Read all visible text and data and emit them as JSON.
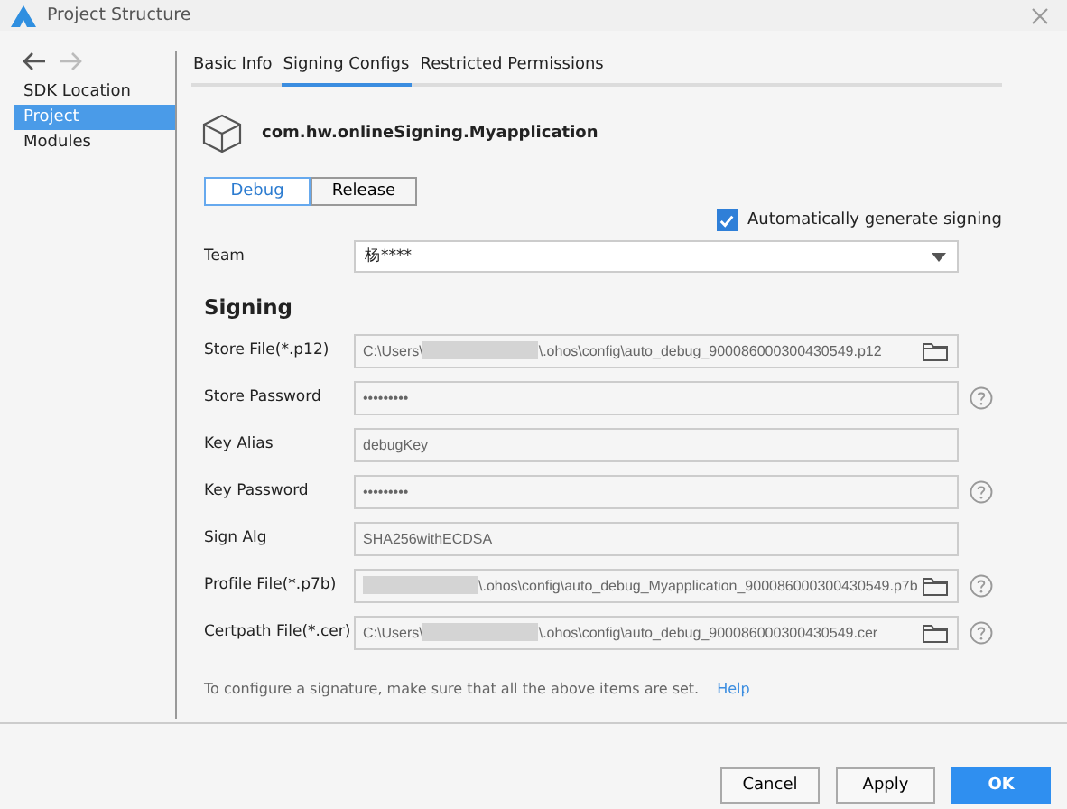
{
  "window": {
    "title": "Project Structure"
  },
  "sidebar": {
    "items": [
      {
        "label": "SDK Location",
        "selected": false
      },
      {
        "label": "Project",
        "selected": true
      },
      {
        "label": "Modules",
        "selected": false
      }
    ]
  },
  "tabs": [
    {
      "label": "Basic Info",
      "selected": false
    },
    {
      "label": "Signing Configs",
      "selected": true
    },
    {
      "label": "Restricted Permissions",
      "selected": false
    }
  ],
  "app_name": "com.hw.onlineSigning.Myapplication",
  "modes": [
    {
      "label": "Debug",
      "selected": true
    },
    {
      "label": "Release",
      "selected": false
    }
  ],
  "auto_generate": {
    "label": "Automatically generate signing",
    "checked": true
  },
  "team": {
    "label": "Team",
    "value": "杨****"
  },
  "section_title": "Signing",
  "fields": [
    {
      "label": "Store File(*.p12)",
      "kind": "file",
      "prefix": "C:\\Users\\",
      "redacted": true,
      "value": "\\.ohos\\config\\auto_debug_900086000300430549.p12",
      "help": false
    },
    {
      "label": "Store Password",
      "kind": "text",
      "value": "•••••••••",
      "help": true
    },
    {
      "label": "Key Alias",
      "kind": "text",
      "value": "debugKey",
      "help": false
    },
    {
      "label": "Key Password",
      "kind": "text",
      "value": "•••••••••",
      "help": true
    },
    {
      "label": "Sign Alg",
      "kind": "text",
      "value": "SHA256withECDSA",
      "help": false
    },
    {
      "label": "Profile File(*.p7b)",
      "kind": "file",
      "redacted": true,
      "value": "\\.ohos\\config\\auto_debug_Myapplication_900086000300430549.p7b",
      "help": true
    },
    {
      "label": "Certpath File(*.cer)",
      "kind": "file",
      "prefix": "C:\\Users\\",
      "redacted": true,
      "value": "\\.ohos\\config\\auto_debug_900086000300430549.cer",
      "help": true
    }
  ],
  "hint": {
    "text": "To configure a signature, make sure that all the above items are set.",
    "link": "Help"
  },
  "buttons": [
    {
      "label": "Cancel",
      "kind": "default"
    },
    {
      "label": "Apply",
      "kind": "default"
    },
    {
      "label": "OK",
      "kind": "primary"
    }
  ]
}
